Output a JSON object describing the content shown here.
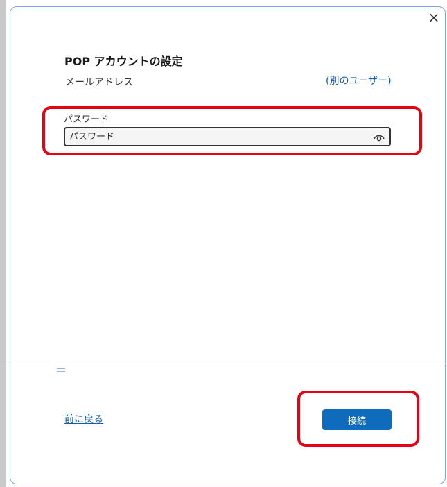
{
  "dialog": {
    "close_glyph": "×",
    "title": "POP アカウントの設定",
    "email_label": "メールアドレス",
    "other_user_link": "(別のユーザー)",
    "password": {
      "label": "パスワード",
      "placeholder": "パスワード",
      "value": ""
    },
    "back_link": "前に戻る",
    "connect_button": "接続"
  },
  "highlight_color": "#e60012",
  "accent_color": "#0f6cbd",
  "link_color": "#0f5bb5",
  "icons": {
    "close": "close-icon",
    "reveal_password": "eye-icon"
  }
}
